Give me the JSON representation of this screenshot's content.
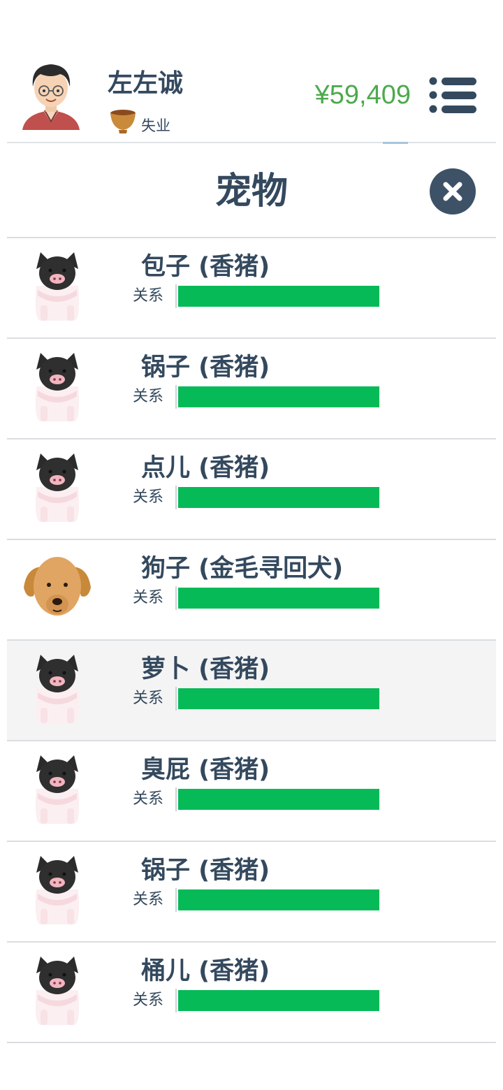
{
  "header": {
    "player_name": "左左诚",
    "job": "失业",
    "money": "¥59,409",
    "money_color": "#4caa4c",
    "avatar_icon": "player-avatar-icon",
    "job_icon": "bowl-icon",
    "menu_icon": "menu-list-icon"
  },
  "page": {
    "title": "宠物",
    "close_icon": "close-icon"
  },
  "colors": {
    "text": "#34495e",
    "relationship_bar": "#07ba58",
    "highlight_row": "#f4f4f4"
  },
  "pets": [
    {
      "name": "包子 (香猪)",
      "relationship_label": "关系",
      "relationship": 1.0,
      "icon": "pig-icon"
    },
    {
      "name": "锅子 (香猪)",
      "relationship_label": "关系",
      "relationship": 1.0,
      "icon": "pig-icon"
    },
    {
      "name": "点儿 (香猪)",
      "relationship_label": "关系",
      "relationship": 1.0,
      "icon": "pig-icon"
    },
    {
      "name": "狗子 (金毛寻回犬)",
      "relationship_label": "关系",
      "relationship": 1.0,
      "icon": "golden-retriever-icon"
    },
    {
      "name": "萝卜 (香猪)",
      "relationship_label": "关系",
      "relationship": 1.0,
      "icon": "pig-icon",
      "highlighted": true
    },
    {
      "name": "臭屁 (香猪)",
      "relationship_label": "关系",
      "relationship": 1.0,
      "icon": "pig-icon"
    },
    {
      "name": "锅子 (香猪)",
      "relationship_label": "关系",
      "relationship": 1.0,
      "icon": "pig-icon"
    },
    {
      "name": "桶儿 (香猪)",
      "relationship_label": "关系",
      "relationship": 1.0,
      "icon": "pig-icon"
    }
  ]
}
